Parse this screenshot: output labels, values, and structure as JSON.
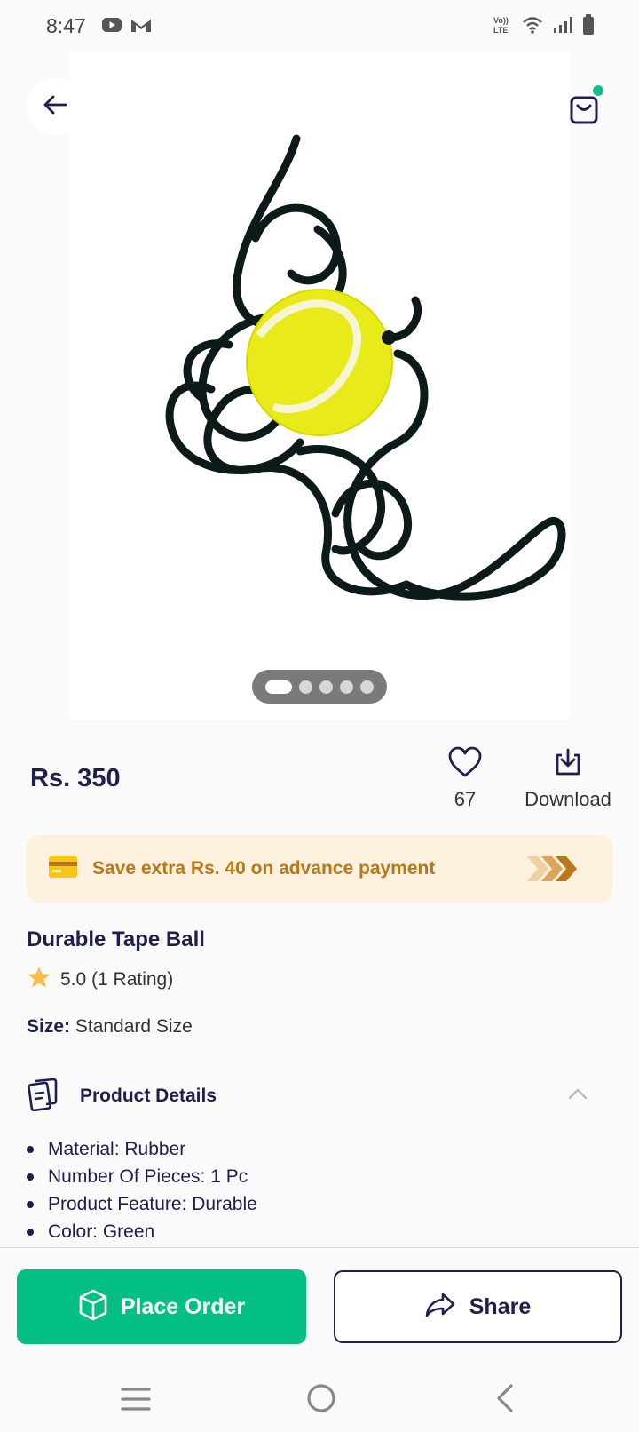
{
  "status_bar": {
    "time": "8:47",
    "lte_label": "Vo LTE",
    "icons": [
      "youtube-icon",
      "gmail-icon",
      "volte-icon",
      "wifi-icon",
      "signal-icon",
      "battery-icon"
    ]
  },
  "header": {
    "back_icon": "arrow-left-icon",
    "cart_icon": "shopping-bag-icon",
    "cart_badge_color": "#1abc8c"
  },
  "gallery": {
    "image_description_icon": "product-image",
    "image_count": 5,
    "active_index": 0
  },
  "pricing": {
    "price": "Rs. 350",
    "wishlist_count": "67",
    "download_label": "Download"
  },
  "banner": {
    "text": "Save extra Rs. 40 on advance payment",
    "text_color": "#b8781a",
    "background": "#fdf0dd"
  },
  "product": {
    "title": "Durable Tape Ball",
    "rating": "5.0 (1 Rating)",
    "size_label": "Size:",
    "size_value": "Standard Size"
  },
  "details": {
    "title": "Product Details",
    "items": [
      "Material: Rubber",
      "Number Of Pieces: 1 Pc",
      "Product Feature: Durable",
      "Color: Green"
    ]
  },
  "actions": {
    "place_order_label": "Place Order",
    "share_label": "Share",
    "accent_color": "#03bf84"
  }
}
